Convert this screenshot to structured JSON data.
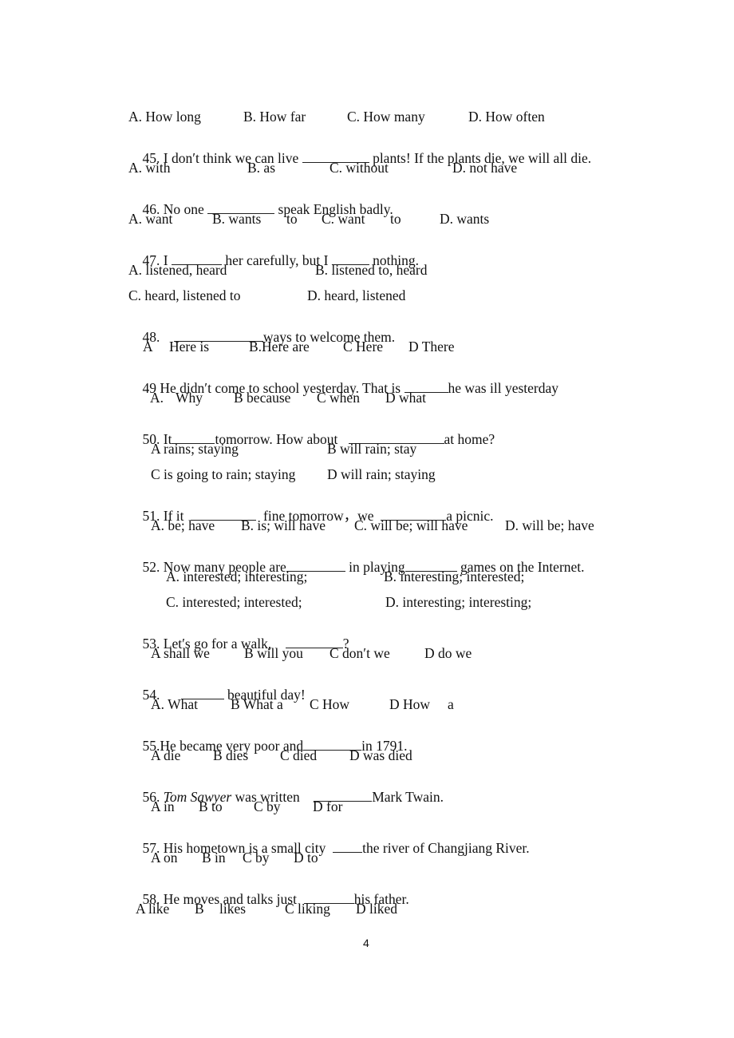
{
  "page_number": "4",
  "q44_options": [
    "A. How long",
    "B. How far",
    "C. How many",
    "D. How often"
  ],
  "questions": [
    {
      "number": "45.",
      "stem": [
        "I don′t think we can live ",
        " plants! If the plants die, we will all die."
      ],
      "options": [
        "A. with",
        "B. as",
        "C. without",
        "D. not have"
      ]
    },
    {
      "number": "46.",
      "stem": [
        "No one ",
        " speak English badly."
      ],
      "options": [
        "A. want",
        "B. wants",
        "to",
        "C. want",
        "to",
        "D. wants"
      ]
    },
    {
      "number": "47.",
      "stem": [
        "I ",
        " her carefully, but I ",
        " nothing."
      ],
      "options": [
        "A. listened, heard",
        "B. listened to, heard",
        "C. heard, listened to",
        "D. heard, listened"
      ]
    },
    {
      "number": "48.",
      "stem": [
        "",
        "ways to welcome them."
      ],
      "options": [
        "A",
        "Here is",
        "B.Here are",
        "C Here",
        "D There"
      ]
    },
    {
      "number": "49",
      "stem": [
        "He didn′t come to school yesterday. That is ",
        "he was ill yesterday"
      ],
      "options": [
        "A.",
        "Why",
        "B because",
        "C when",
        "D what"
      ]
    },
    {
      "number": "50.",
      "stem": [
        "It",
        "tomorrow. How about ",
        "at home?"
      ],
      "options": [
        "A rains; staying",
        "B will rain; stay",
        "C is going to rain; staying",
        "D will rain; staying"
      ]
    },
    {
      "number": "51.",
      "stem": [
        "If it ",
        " fine tomorrow，we ",
        "a picnic."
      ],
      "options": [
        "A. be; have",
        "B. is; will have",
        "C. will be; will have",
        "D. will be; have"
      ]
    },
    {
      "number": "52.",
      "stem": [
        "Now many people are",
        " in playing",
        " games on the Internet."
      ],
      "options": [
        "A. interested; interesting;",
        "B. interesting; interested;",
        "C. interested; interested;",
        "D. interesting; interesting;"
      ]
    },
    {
      "number": "53.",
      "stem": [
        "Let′s go for a walk, ",
        "?"
      ],
      "options": [
        "A shall we",
        "B will you",
        "C don′t we",
        "D do we"
      ]
    },
    {
      "number": "54.",
      "stem": [
        "",
        " beautiful day!"
      ],
      "options": [
        "A. What",
        "B What a",
        "C How",
        "D How",
        "a"
      ]
    },
    {
      "number": "55.",
      "stem": [
        "He became very poor and",
        "in 1791."
      ],
      "options": [
        "A die",
        "B dies",
        "C died",
        "D was died"
      ]
    },
    {
      "number": "56.",
      "stem_italic": "Tom Sawyer",
      "stem": [
        " was written ",
        "Mark Twain."
      ],
      "options": [
        "A in",
        "B to",
        "C by",
        "D for"
      ]
    },
    {
      "number": "57.",
      "stem": [
        "His hometown is a small city ",
        "the river of Changjiang River."
      ],
      "options": [
        "A on",
        "B in",
        "C by",
        "D to"
      ]
    },
    {
      "number": "58.",
      "stem": [
        "He moves and talks just ",
        "his father."
      ],
      "options": [
        "A like",
        "B",
        "likes",
        "C liking",
        "D liked"
      ]
    }
  ]
}
